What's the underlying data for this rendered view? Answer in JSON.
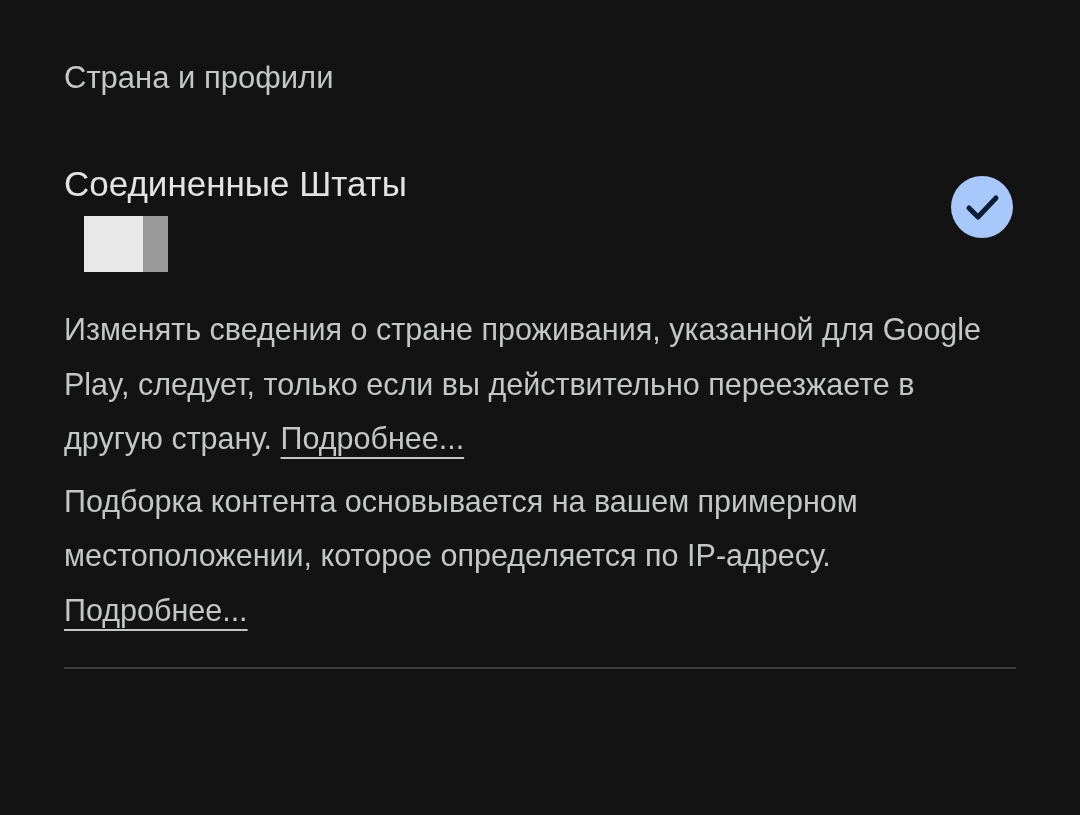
{
  "section_title": "Страна и профили",
  "countries": [
    {
      "name": "Соединенные Штаты",
      "redacted": true,
      "selected": true
    }
  ],
  "notes": [
    {
      "text": "Изменять сведения о стране проживания, указанной для Google Play, следует, только если вы действительно переезжаете в другую страну.",
      "link": "Подробнее..."
    },
    {
      "text": "Подборка контента основывается на вашем примерном местоположении, которое определяется по IP-адресу.",
      "link": "Подробнее..."
    }
  ]
}
